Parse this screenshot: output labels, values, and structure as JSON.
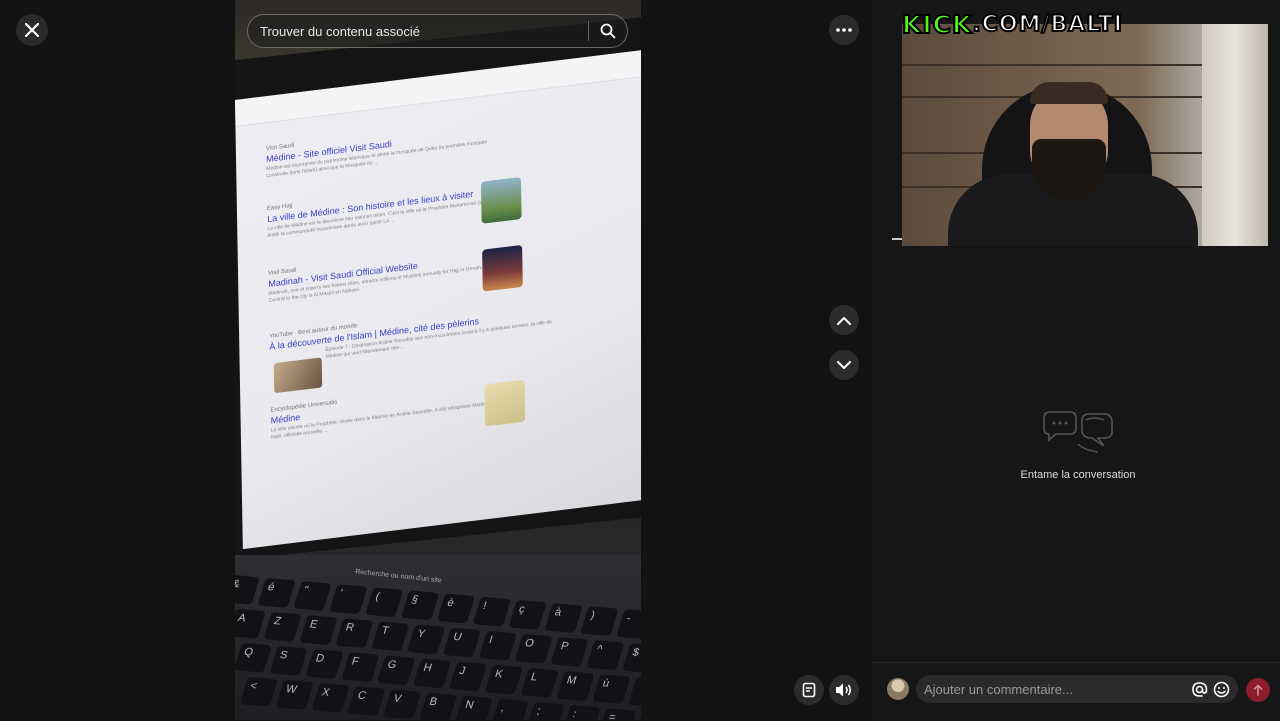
{
  "viewer": {
    "close_icon": "close-icon",
    "more_icon": "more-options-icon",
    "prev_icon": "chevron-up-icon",
    "next_icon": "chevron-down-icon",
    "caption_icon": "caption-icon",
    "volume_icon": "volume-icon"
  },
  "search": {
    "placeholder": "Trouver du contenu associé",
    "icon": "search-icon"
  },
  "video_screen": {
    "results": [
      {
        "source": "Visit Saudi",
        "title": "Médine - Site officiel Visit Saudi",
        "snippet": "Médine est imprégnée du patrimoine islamique et abrite la mosquée de Quba (la première mosquée construite dans l'islam) ainsi que la Mosquée du ..."
      },
      {
        "source": "Easy Hajj",
        "title": "La ville de Médine : Son histoire et les lieux à visiter",
        "snippet": "La ville de Médine est le deuxième lieu saint en islam. C'est la ville où le Prophète Muhammad (saw) a établi la communauté musulmane après avoir quitté La ..."
      },
      {
        "source": "Visit Saudi",
        "title": "Madinah - Visit Saudi Official Website",
        "snippet": "Madinah, one of Islam's two holiest cities, attracts millions of Muslims annually for Hajj or Umrah. Central to the city is Al Masjid an Nabawi."
      },
      {
        "source": "YouTube · Best autour du monde",
        "title": "À la découverte de l'Islam | Médine, cité des pèlerins",
        "snippet": "Épisode 7 : Destination Arabie Saoudite aux non-musulmans jusqu'à il y a quelques années, la ville de Médine qui veut littéralement dire ..."
      },
      {
        "source": "Encyclopédie Universalis",
        "title": "Médine",
        "snippet": "La ville sacrée où le Prophète, située dans le Médine en Arabie Saoudite. À été rebaptisée Madinat al-Nabi, officielle nouvelle ..."
      }
    ],
    "keyboard_label": "Recherche ou nom d'un site",
    "keys_row1": [
      "&",
      "é",
      "\"",
      "'",
      "(",
      "§",
      "è",
      "!",
      "ç",
      "à",
      ")",
      "-"
    ],
    "keys_row2": [
      "A",
      "Z",
      "E",
      "R",
      "T",
      "Y",
      "U",
      "I",
      "O",
      "P",
      "^",
      "$"
    ],
    "keys_row3": [
      "Q",
      "S",
      "D",
      "F",
      "G",
      "H",
      "J",
      "K",
      "L",
      "M",
      "ù",
      "`"
    ],
    "keys_row4": [
      "<",
      "W",
      "X",
      "C",
      "V",
      "B",
      "N",
      ",",
      ";",
      ":",
      "=",
      "↑"
    ]
  },
  "stream_overlay": {
    "kick_logo": "KICK",
    "kick_domain": ".COM/BALTI"
  },
  "comments": {
    "empty_text": "Entame la conversation",
    "empty_icon": "chat-bubbles-icon",
    "input_placeholder": "Ajouter un commentaire...",
    "mention_icon": "at-mention-icon",
    "emoji_icon": "emoji-icon",
    "send_icon": "send-arrow-icon"
  },
  "colors": {
    "kick_green": "#53fc18",
    "send_button": "#8a1c2b",
    "background": "#121212"
  }
}
